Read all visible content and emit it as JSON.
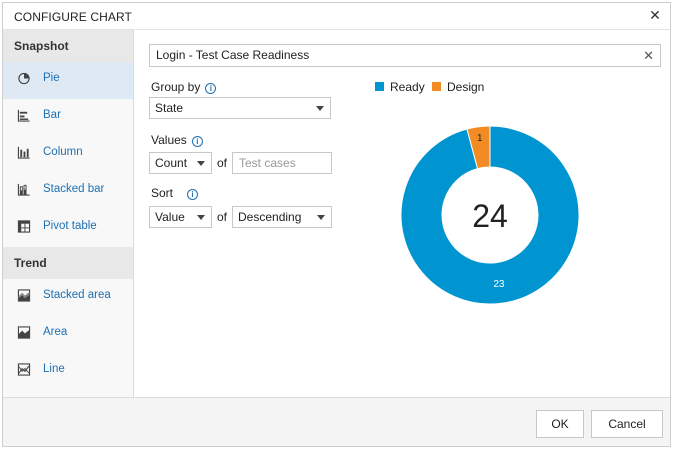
{
  "dialog": {
    "title": "CONFIGURE CHART"
  },
  "sidebar": {
    "snapshot_header": "Snapshot",
    "snapshot_items": [
      {
        "label": "Pie",
        "icon": "pie-chart-icon",
        "selected": true
      },
      {
        "label": "Bar",
        "icon": "bar-chart-icon"
      },
      {
        "label": "Column",
        "icon": "column-chart-icon"
      },
      {
        "label": "Stacked bar",
        "icon": "stacked-bar-chart-icon"
      },
      {
        "label": "Pivot table",
        "icon": "pivot-table-icon"
      }
    ],
    "trend_header": "Trend",
    "trend_items": [
      {
        "label": "Stacked area",
        "icon": "stacked-area-chart-icon"
      },
      {
        "label": "Area",
        "icon": "area-chart-icon"
      },
      {
        "label": "Line",
        "icon": "line-chart-icon"
      }
    ]
  },
  "config": {
    "chart_name": "Login - Test Case Readiness",
    "group_by_label": "Group by",
    "group_by_value": "State",
    "values_label": "Values",
    "values_aggregate": "Count",
    "of_text": "of",
    "values_field_placeholder": "Test cases",
    "sort_label": "Sort",
    "sort_by": "Value",
    "sort_order": "Descending"
  },
  "chart_data": {
    "type": "pie",
    "style": "donut",
    "total_label": "24",
    "slices": [
      {
        "name": "Ready",
        "value": 23,
        "color": "#0095d1"
      },
      {
        "name": "Design",
        "value": 1,
        "color": "#f28b23"
      }
    ],
    "legend": [
      "Ready",
      "Design"
    ],
    "legend_position": "top"
  },
  "footer": {
    "ok_label": "OK",
    "cancel_label": "Cancel"
  },
  "colors": {
    "accent": "#1d6fb3",
    "selected_bg": "#dfe9f4"
  }
}
